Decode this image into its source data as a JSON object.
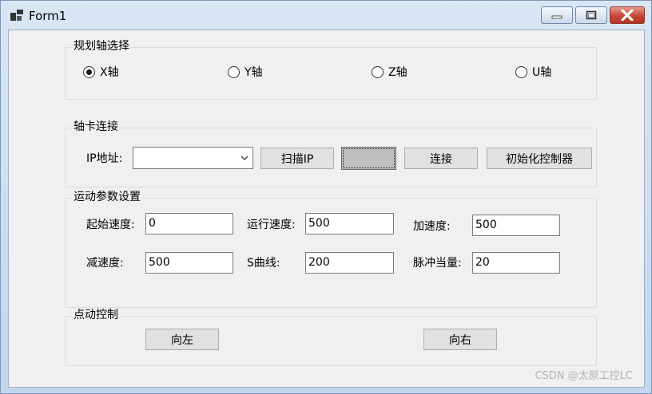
{
  "window": {
    "title": "Form1"
  },
  "groups": {
    "axis_select": {
      "title": "规划轴选择",
      "options": [
        {
          "label": "X轴",
          "checked": true
        },
        {
          "label": "Y轴",
          "checked": false
        },
        {
          "label": "Z轴",
          "checked": false
        },
        {
          "label": "U轴",
          "checked": false
        }
      ]
    },
    "connection": {
      "title": "轴卡连接",
      "ip_label": "IP地址:",
      "ip_value": "",
      "scan_button": "扫描IP",
      "blank_button": "",
      "connect_button": "连接",
      "init_button": "初始化控制器"
    },
    "motion": {
      "title": "运动参数设置",
      "start_speed_label": "起始速度:",
      "start_speed_value": "0",
      "run_speed_label": "运行速度:",
      "run_speed_value": "500",
      "accel_label": "加速度:",
      "accel_value": "500",
      "decel_label": "减速度:",
      "decel_value": "500",
      "scurve_label": "S曲线:",
      "scurve_value": "200",
      "pulse_label": "脉冲当量:",
      "pulse_value": "20"
    },
    "jog": {
      "title": "点动控制",
      "left_button": "向左",
      "right_button": "向右"
    }
  },
  "watermark": "CSDN @太原工控LC"
}
